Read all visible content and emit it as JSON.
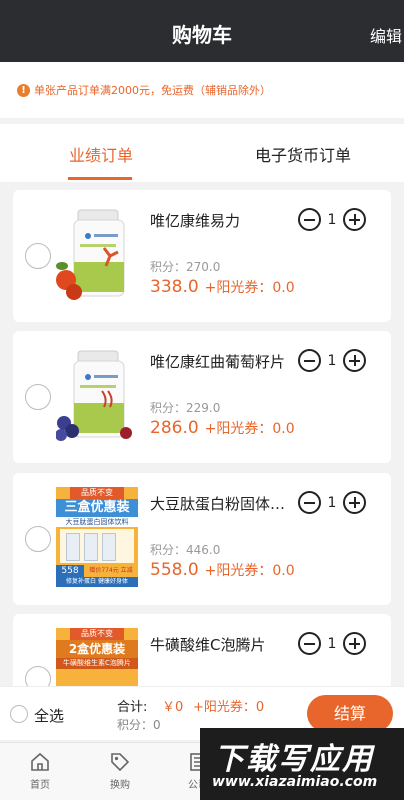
{
  "header": {
    "title": "购物车",
    "edit_label": "编辑"
  },
  "notice": {
    "icon": "exclamation-circle-icon",
    "text": "单张产品订单满2000元，免运费（辅销品除外）"
  },
  "tabs": [
    {
      "label": "业绩订单",
      "active": true
    },
    {
      "label": "电子货币订单",
      "active": false
    }
  ],
  "items": [
    {
      "name": "唯亿康维易力",
      "quantity": "1",
      "points": "积分：270.0",
      "price": "338.0",
      "sun": "+阳光券：0.0"
    },
    {
      "name": "唯亿康红曲葡萄籽片",
      "quantity": "1",
      "points": "积分：229.0",
      "price": "286.0",
      "sun": "+阳光券：0.0"
    },
    {
      "name": "大豆肽蛋白粉固体饮料",
      "quantity": "1",
      "points": "积分：446.0",
      "price": "558.0",
      "sun": "+阳光券：0.0"
    },
    {
      "name": "牛磺酸维C泡腾片",
      "quantity": "1",
      "points": "",
      "price": "",
      "sun": ""
    }
  ],
  "thumb_text": {
    "item3_top": "品质不变",
    "item3_title": "三盒优惠装",
    "item3_sub": "大豆肽蛋白固体饮料",
    "item3_bottom": "修复补蛋白 健康好身体",
    "item3_price_left": "558",
    "item3_badge": "赠价774元 立减216",
    "item4_top": "品质不变",
    "item4_title": "2盒优惠装",
    "item4_sub": "牛磺酸维生素C泡腾片"
  },
  "footer": {
    "select_all_label": "全选",
    "total_label": "合计:",
    "total_value": "￥0",
    "total_sun": "+阳光券：0",
    "total_points": "积分：0",
    "checkout_label": "结算"
  },
  "tabbar": [
    {
      "label": "首页",
      "icon": "home-icon"
    },
    {
      "label": "换购",
      "icon": "tag-icon"
    },
    {
      "label": "公司",
      "icon": "company-icon"
    }
  ],
  "watermark": {
    "big": "下载写应用",
    "small": "www.xiazaimiao.com"
  },
  "colors": {
    "accent": "#e8652b",
    "header_bg": "#2b2d31"
  }
}
